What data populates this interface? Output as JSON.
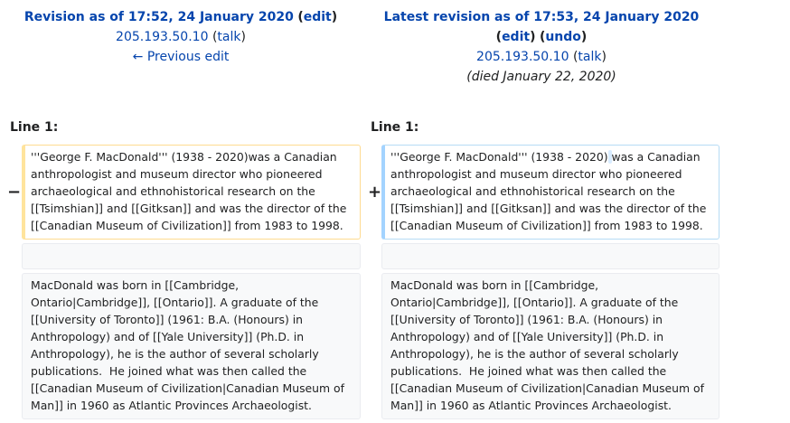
{
  "old_revision": {
    "title": "Revision as of 17:52, 24 January 2020",
    "edit_link": "edit",
    "user": "205.193.50.10",
    "talk_link": "talk",
    "previous_edit": "← Previous edit"
  },
  "new_revision": {
    "title": "Latest revision as of 17:53, 24 January 2020",
    "edit_link": "edit",
    "undo_link": "undo",
    "user": "205.193.50.10",
    "talk_link": "talk",
    "summary": "(died January 22, 2020)"
  },
  "diff": {
    "left_line_label": "Line 1:",
    "right_line_label": "Line 1:",
    "deleted_marker": "−",
    "added_marker": "+",
    "old_para1_before": "'''George F. MacDonald''' (1938 - 2020)",
    "old_para1_after": "was a Canadian anthropologist and museum director who pioneered archaeological and ethnohistorical research on the [[Tsimshian]] and [[Gitksan]] and was the director of the [[Canadian Museum of Civilization]] from 1983 to 1998.",
    "new_para1_before": "'''George F. MacDonald''' (1938 - 2020)",
    "new_para1_inserted": " ",
    "new_para1_after": "was a Canadian anthropologist and museum director who pioneered archaeological and ethnohistorical research on the [[Tsimshian]] and [[Gitksan]] and was the director of the [[Canadian Museum of Civilization]] from 1983 to 1998.",
    "context_para2_left": "MacDonald was born in [[Cambridge, Ontario|Cambridge]], [[Ontario]]. A graduate of the [[University of Toronto]] (1961: B.A. (Honours) in Anthropology) and of [[Yale University]] (Ph.D. in Anthropology), he is the author of several scholarly publications.  He joined what was then called the [[Canadian Museum of Civilization|Canadian Museum of Man]] in 1960 as Atlantic Provinces Archaeologist.",
    "context_para2_right": "MacDonald was born in [[Cambridge, Ontario|Cambridge]], [[Ontario]]. A graduate of the [[University of Toronto]] (1961: B.A. (Honours) in Anthropology) and of [[Yale University]] (Ph.D. in Anthropology), he is the author of several scholarly publications.  He joined what was then called the [[Canadian Museum of Civilization|Canadian Museum of Man]] in 1960 as Atlantic Provinces Archaeologist."
  },
  "colors": {
    "link": "#0645ad",
    "deleted_border": "#ffe49c",
    "added_border": "#a3d3ff",
    "context_bg": "#f8f9fa",
    "inserted_highlight": "#d8ecff"
  }
}
